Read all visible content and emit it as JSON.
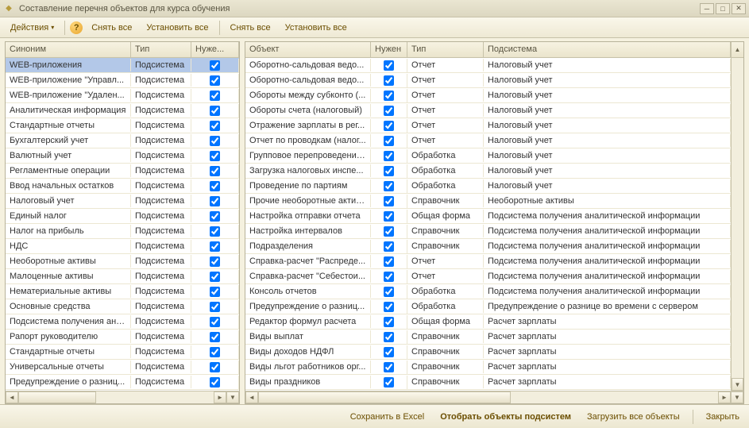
{
  "window": {
    "title": "Составление перечня объектов для курса обучения"
  },
  "toolbar": {
    "actions": "Действия",
    "left_clear_all": "Снять все",
    "left_set_all": "Установить все",
    "right_clear_all": "Снять все",
    "right_set_all": "Установить все"
  },
  "left_grid": {
    "headers": {
      "synonym": "Синоним",
      "type": "Тип",
      "needed": "Нуже..."
    },
    "rows": [
      {
        "syn": "WEB-приложения",
        "type": "Подсистема",
        "needed": true,
        "sel": true
      },
      {
        "syn": "WEB-приложение \"Управл...",
        "type": "Подсистема",
        "needed": true
      },
      {
        "syn": "WEB-приложение \"Удален...",
        "type": "Подсистема",
        "needed": true
      },
      {
        "syn": "Аналитическая информация",
        "type": "Подсистема",
        "needed": true
      },
      {
        "syn": "Стандартные отчеты",
        "type": "Подсистема",
        "needed": true
      },
      {
        "syn": "Бухгалтерский учет",
        "type": "Подсистема",
        "needed": true
      },
      {
        "syn": "Валютный учет",
        "type": "Подсистема",
        "needed": true
      },
      {
        "syn": "Регламентные операции",
        "type": "Подсистема",
        "needed": true
      },
      {
        "syn": "Ввод начальных остатков",
        "type": "Подсистема",
        "needed": true
      },
      {
        "syn": "Налоговый учет",
        "type": "Подсистема",
        "needed": true
      },
      {
        "syn": "Единый налог",
        "type": "Подсистема",
        "needed": true
      },
      {
        "syn": "Налог на прибыль",
        "type": "Подсистема",
        "needed": true
      },
      {
        "syn": "НДС",
        "type": "Подсистема",
        "needed": true
      },
      {
        "syn": "Необоротные активы",
        "type": "Подсистема",
        "needed": true
      },
      {
        "syn": "Малоценные активы",
        "type": "Подсистема",
        "needed": true
      },
      {
        "syn": "Нематериальные активы",
        "type": "Подсистема",
        "needed": true
      },
      {
        "syn": "Основные средства",
        "type": "Подсистема",
        "needed": true
      },
      {
        "syn": "Подсистема получения ана...",
        "type": "Подсистема",
        "needed": true
      },
      {
        "syn": "Рапорт руководителю",
        "type": "Подсистема",
        "needed": true
      },
      {
        "syn": "Стандартные отчеты",
        "type": "Подсистема",
        "needed": true
      },
      {
        "syn": "Универсальные отчеты",
        "type": "Подсистема",
        "needed": true
      },
      {
        "syn": "Предупреждение о разниц...",
        "type": "Подсистема",
        "needed": true
      }
    ]
  },
  "right_grid": {
    "headers": {
      "object": "Объект",
      "needed": "Нужен",
      "type": "Тип",
      "subsystem": "Подсистема"
    },
    "rows": [
      {
        "obj": "Оборотно-сальдовая ведо...",
        "needed": true,
        "type": "Отчет",
        "sub": "Налоговый учет"
      },
      {
        "obj": "Оборотно-сальдовая ведо...",
        "needed": true,
        "type": "Отчет",
        "sub": "Налоговый учет"
      },
      {
        "obj": "Обороты между субконто (...",
        "needed": true,
        "type": "Отчет",
        "sub": "Налоговый учет"
      },
      {
        "obj": "Обороты счета (налоговый)",
        "needed": true,
        "type": "Отчет",
        "sub": "Налоговый учет"
      },
      {
        "obj": "Отражение зарплаты в рег...",
        "needed": true,
        "type": "Отчет",
        "sub": "Налоговый учет"
      },
      {
        "obj": "Отчет по проводкам (налог...",
        "needed": true,
        "type": "Отчет",
        "sub": "Налоговый учет"
      },
      {
        "obj": "Групповое перепроведение...",
        "needed": true,
        "type": "Обработка",
        "sub": "Налоговый учет"
      },
      {
        "obj": "Загрузка налоговых инспе...",
        "needed": true,
        "type": "Обработка",
        "sub": "Налоговый учет"
      },
      {
        "obj": "Проведение по партиям",
        "needed": true,
        "type": "Обработка",
        "sub": "Налоговый учет"
      },
      {
        "obj": "Прочие необоротные активы",
        "needed": true,
        "type": "Справочник",
        "sub": "Необоротные активы"
      },
      {
        "obj": "Настройка отправки отчета",
        "needed": true,
        "type": "Общая форма",
        "sub": "Подсистема получения аналитической информации"
      },
      {
        "obj": "Настройка интервалов",
        "needed": true,
        "type": "Справочник",
        "sub": "Подсистема получения аналитической информации"
      },
      {
        "obj": "Подразделения",
        "needed": true,
        "type": "Справочник",
        "sub": "Подсистема получения аналитической информации"
      },
      {
        "obj": "Справка-расчет \"Распреде...",
        "needed": true,
        "type": "Отчет",
        "sub": "Подсистема получения аналитической информации"
      },
      {
        "obj": "Справка-расчет \"Себестои...",
        "needed": true,
        "type": "Отчет",
        "sub": "Подсистема получения аналитической информации"
      },
      {
        "obj": "Консоль отчетов",
        "needed": true,
        "type": "Обработка",
        "sub": "Подсистема получения аналитической информации"
      },
      {
        "obj": "Предупреждение о разниц...",
        "needed": true,
        "type": "Обработка",
        "sub": "Предупреждение о разнице во времени с сервером"
      },
      {
        "obj": "Редактор формул расчета",
        "needed": true,
        "type": "Общая форма",
        "sub": "Расчет зарплаты"
      },
      {
        "obj": "Виды выплат",
        "needed": true,
        "type": "Справочник",
        "sub": "Расчет зарплаты"
      },
      {
        "obj": "Виды доходов НДФЛ",
        "needed": true,
        "type": "Справочник",
        "sub": "Расчет зарплаты"
      },
      {
        "obj": "Виды льгот работников орг...",
        "needed": true,
        "type": "Справочник",
        "sub": "Расчет зарплаты"
      },
      {
        "obj": "Виды праздников",
        "needed": true,
        "type": "Справочник",
        "sub": "Расчет зарплаты"
      }
    ]
  },
  "footer": {
    "save_excel": "Сохранить в Excel",
    "select_objects": "Отобрать объекты подсистем",
    "load_all": "Загрузить все объекты",
    "close": "Закрыть"
  }
}
